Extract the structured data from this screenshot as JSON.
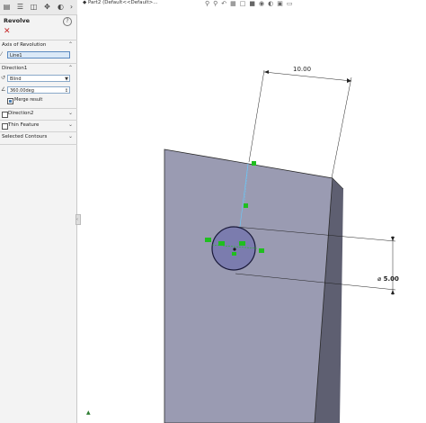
{
  "breadcrumb": {
    "part": "Part2",
    "config": "(Default<<Default>..."
  },
  "panel": {
    "tabs": [
      "feature-manager",
      "property-manager",
      "configuration-manager",
      "dim-xpert",
      "display-manager"
    ],
    "feature_title": "Revolve",
    "help_glyph": "?",
    "axis_section": {
      "title": "Axis of Revolution",
      "value": "Line1"
    },
    "direction1": {
      "title": "Direction1",
      "end_condition": "Blind",
      "angle": "360.00deg",
      "merge_label": "Merge result"
    },
    "direction2": {
      "title": "Direction2"
    },
    "thin_feature": {
      "title": "Thin Feature"
    },
    "contours": {
      "title": "Selected Contours"
    }
  },
  "dimensions": {
    "width": "10.00",
    "diameter": "⌀ 5.00"
  },
  "colors": {
    "face_front": "#9a9bb2",
    "face_side": "#5e5f71",
    "sketch_green": "#1fbf1f",
    "circle_fill": "#7b7cae"
  }
}
